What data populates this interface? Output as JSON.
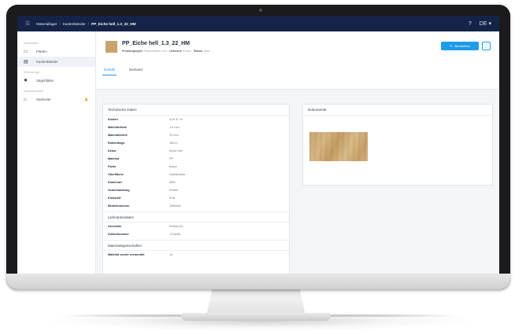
{
  "topbar": {
    "menu_icon": "hamburger-menu-icon",
    "breadcrumb": [
      "Materiallager",
      "Kantenbänder",
      "PP_Eiche hell_1.3_22_HM"
    ],
    "help_icon": "help-icon",
    "language": "DE",
    "language_caret": "▾"
  },
  "sidebar": {
    "sections": [
      {
        "label": "Materialien",
        "items": [
          {
            "label": "Platten",
            "icon": "panel-icon",
            "active": false
          },
          {
            "label": "Kantenbänder",
            "icon": "edgeband-icon",
            "active": true
          }
        ]
      },
      {
        "label": "Werkzeuge",
        "items": [
          {
            "label": "Sägeblätter",
            "icon": "sawblade-icon",
            "active": false
          }
        ]
      },
      {
        "label": "Administration",
        "items": [
          {
            "label": "Startseite",
            "icon": "home-icon",
            "active": false,
            "warning": true
          }
        ]
      }
    ]
  },
  "header": {
    "title": "PP_Eiche hell_1.3_22_HM",
    "meta": [
      {
        "label": "Produktgruppe:",
        "value": "Pflanzenfaser hell"
      },
      {
        "label": "Lieferant:",
        "value": "Rehau"
      },
      {
        "label": "Status:",
        "value": "aktiv"
      }
    ],
    "edit_label": "Bearbeiten",
    "edit_icon": "pencil-icon",
    "more_label": "⋮",
    "tabs": [
      {
        "label": "Details",
        "active": true
      },
      {
        "label": "Bestand",
        "active": false
      }
    ]
  },
  "details_card": {
    "title": "Technische Daten",
    "rows": [
      {
        "key": "Kosten",
        "value": "0,09 € / m"
      },
      {
        "key": "Materialdicke",
        "value": "1,3 mm"
      },
      {
        "key": "Materialbreite",
        "value": "22 mm"
      },
      {
        "key": "Rollenlänge",
        "value": "150 m"
      },
      {
        "key": "Dekor",
        "value": "Eiche hell"
      },
      {
        "key": "Material",
        "value": "PP"
      },
      {
        "key": "Farbe",
        "value": "braun"
      },
      {
        "key": "Oberfläche",
        "value": "Holzstruktur"
      },
      {
        "key": "Kantenart",
        "value": "ABS"
      },
      {
        "key": "Vorbehandlung",
        "value": "Primer"
      },
      {
        "key": "Klebstoff",
        "value": "EVA"
      },
      {
        "key": "Bestellnummer",
        "value": "1086452"
      }
    ],
    "sections": [
      {
        "title": "Lieferantendaten",
        "rows": [
          {
            "key": "Hersteller",
            "value": "Rehau AG"
          },
          {
            "key": "Artikelnummer",
            "value": "1724841"
          }
        ]
      },
      {
        "title": "Materialeigenschaften",
        "rows": [
          {
            "key": "Material wurde verwendet",
            "value": "Ja"
          }
        ]
      }
    ]
  },
  "documents_card": {
    "title": "Dokumente",
    "image_label": "Dekorbild Eiche hell"
  }
}
